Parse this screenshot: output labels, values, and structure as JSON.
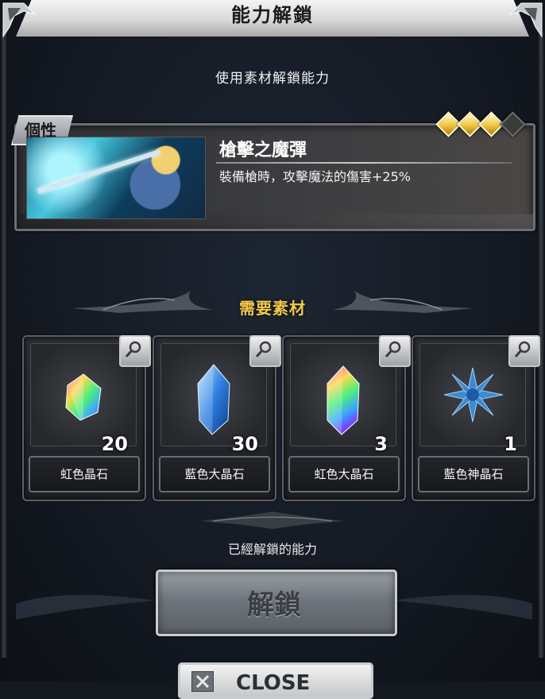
{
  "header": {
    "title": "能力解鎖"
  },
  "subtitle": "使用素材解鎖能力",
  "ability": {
    "tag": "個性",
    "name": "槍擊之魔彈",
    "description": "裝備槍時，攻擊魔法的傷害+25%",
    "rank": {
      "filled": 3,
      "total": 4
    }
  },
  "materials_section": {
    "title": "需要素材",
    "items": [
      {
        "name": "虹色晶石",
        "count": "20",
        "icon": "rainbow-crystal-icon"
      },
      {
        "name": "藍色大晶石",
        "count": "30",
        "icon": "blue-large-crystal-icon"
      },
      {
        "name": "虹色大晶石",
        "count": "3",
        "icon": "rainbow-large-crystal-icon"
      },
      {
        "name": "藍色神晶石",
        "count": "1",
        "icon": "blue-divine-crystal-icon"
      }
    ]
  },
  "unlocked": {
    "label": "已經解鎖的能力",
    "button_label": "解鎖"
  },
  "close": {
    "label": "CLOSE"
  },
  "colors": {
    "accent_gold": "#f4c94a",
    "diamond_gold": "#f0c640"
  }
}
